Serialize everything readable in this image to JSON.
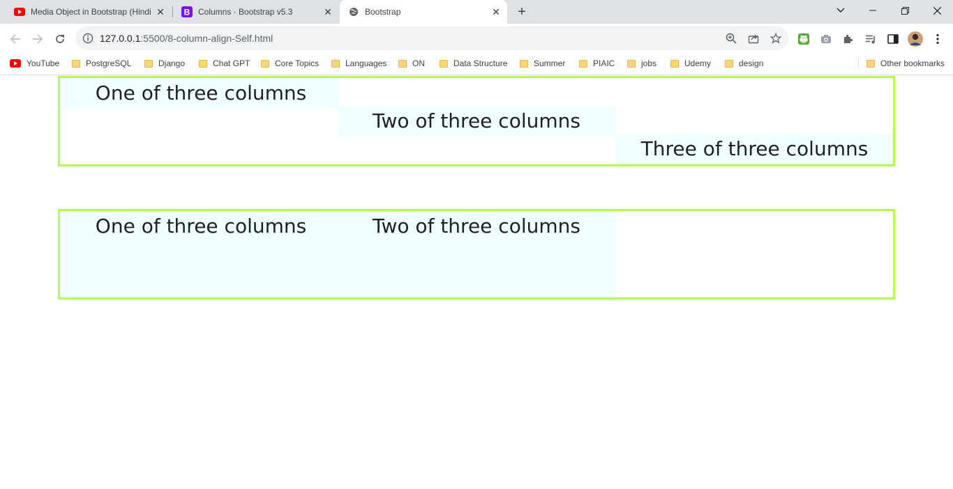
{
  "tabs": [
    {
      "title": "Media Object in Bootstrap (Hindi",
      "favicon": "youtube-icon",
      "active": false
    },
    {
      "title": "Columns · Bootstrap v5.3",
      "favicon": "bootstrap-icon",
      "active": false
    },
    {
      "title": "Bootstrap",
      "favicon": "globe-icon",
      "active": true
    }
  ],
  "address_bar": {
    "host": "127.0.0.1",
    "path": ":5500/8-column-align-Self.html"
  },
  "bookmarks": {
    "items": [
      "YouTube",
      "PostgreSQL",
      "Django",
      "Chat GPT",
      "Core Topics",
      "Languages",
      "ON",
      "Data Structure",
      "Summer",
      "PIAIC",
      "jobs",
      "Udemy",
      "design"
    ],
    "other": "Other bookmarks"
  },
  "page": {
    "row1": {
      "col1": "One of three columns",
      "col2": "Two of three columns",
      "col3": "Three of three columns"
    },
    "row2": {
      "col1": "One of three columns",
      "col2": "Two of three columns"
    }
  },
  "colors": {
    "row_border": "#b2ff4d",
    "column_background": "#f0ffff",
    "tabstrip": "#dee1e6"
  }
}
